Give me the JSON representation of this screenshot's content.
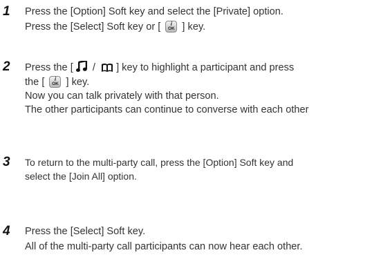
{
  "steps": [
    {
      "number": "1",
      "lines": [
        "Press the [Option] Soft key and select the [Private] option.",
        "Press the [Select] Soft key or [",
        "] key."
      ]
    },
    {
      "number": "2",
      "lines": [
        "Press the [",
        "/",
        "] key to highlight a participant and press",
        "the  [",
        "] key.",
        "Now you can talk privately with that person.",
        "The other participants can continue to converse with each other"
      ]
    },
    {
      "number": "3",
      "lines": [
        "To return to the multi-party call, press the [Option] Soft key and",
        "select the [Join All] option."
      ]
    },
    {
      "number": "4",
      "lines": [
        "Press the [Select] Soft key.",
        "All of the multi-party call participants can now hear each other."
      ]
    }
  ],
  "icons": {
    "ok_key_top": "i",
    "ok_key_bottom": "OK",
    "music_icon": "music-note-icon",
    "phonebook_icon": "book-icon"
  }
}
